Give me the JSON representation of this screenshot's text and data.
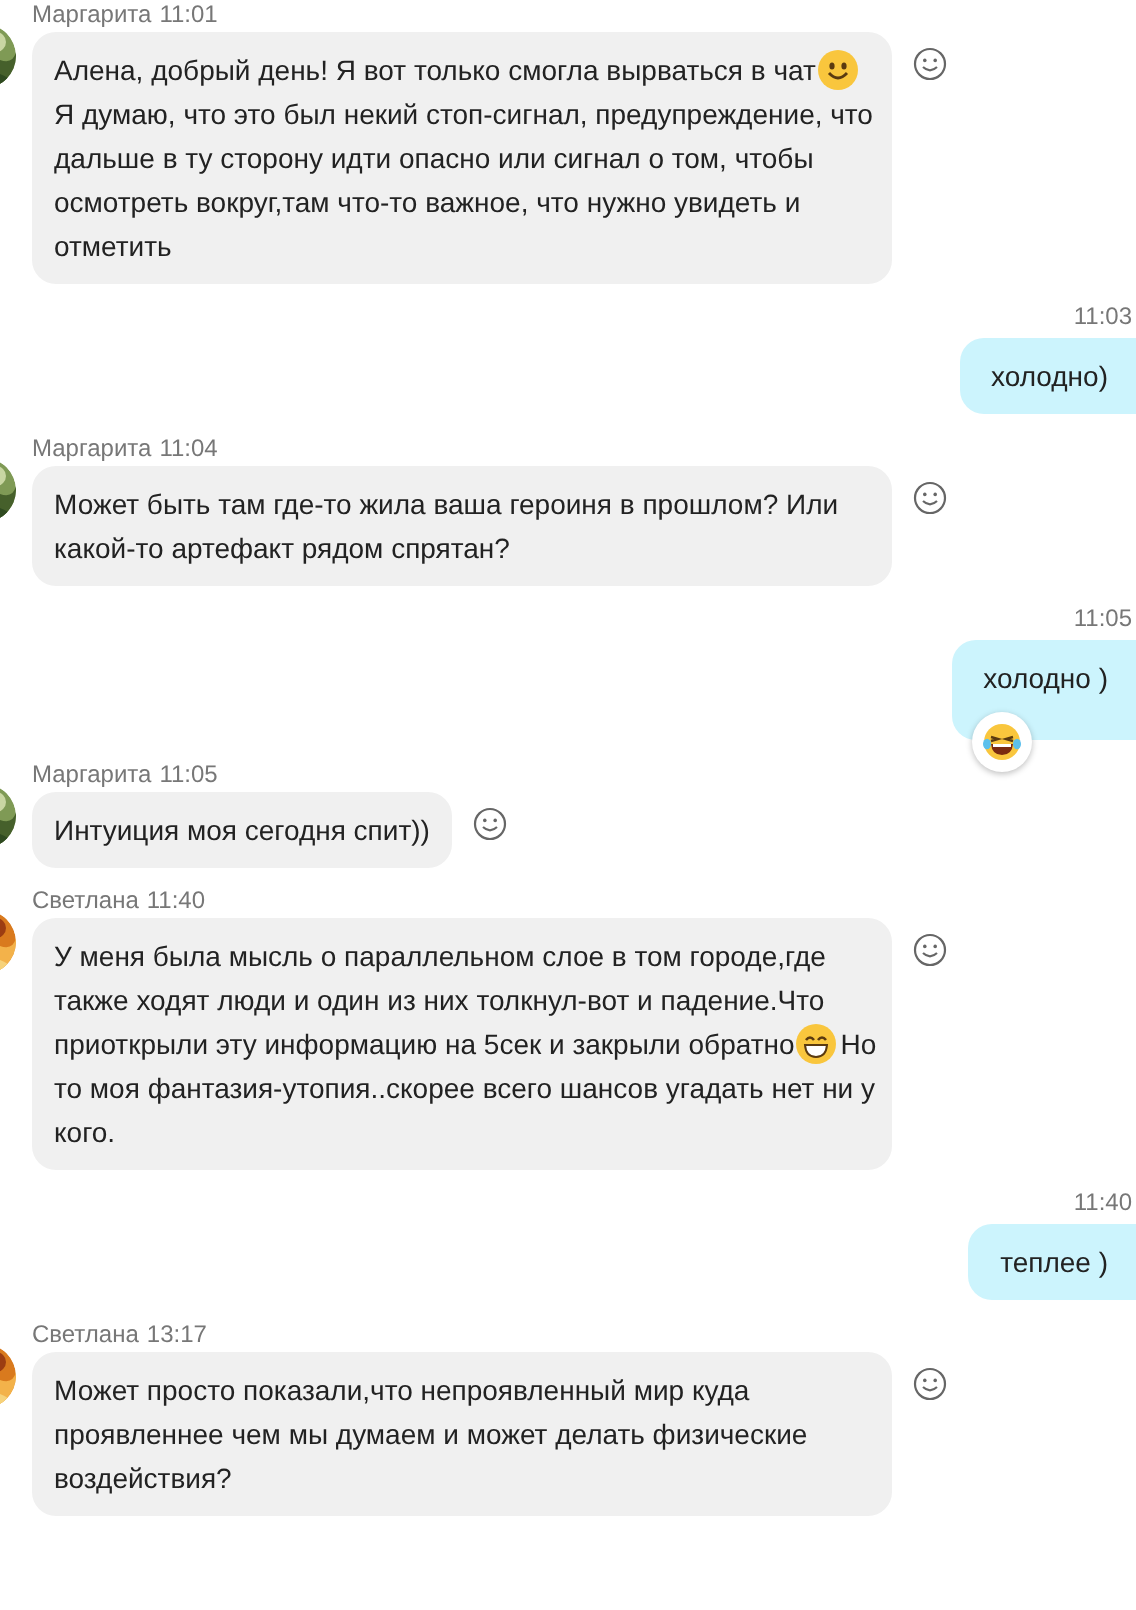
{
  "messages": [
    {
      "kind": "incoming",
      "author": "Маргарита",
      "time": "11:01",
      "avatar": {
        "kind": "picture"
      },
      "lines": [
        [
          {
            "kind": "text",
            "text": "Алена, добрый день! Я вот только смогла вырваться в чат"
          },
          {
            "kind": "smile"
          }
        ],
        [
          {
            "kind": "text",
            "text": "Я думаю, что это был некий стоп-сигнал, предупреждение, что"
          }
        ],
        [
          {
            "kind": "text",
            "text": "дальше в ту сторону идти опасно или сигнал о том, чтобы"
          }
        ],
        [
          {
            "kind": "text",
            "text": "осмотреть вокруг,там что-то важное, что нужно увидеть и"
          }
        ],
        [
          {
            "kind": "text",
            "text": "отметить"
          }
        ]
      ]
    },
    {
      "kind": "outgoing",
      "time": "11:03",
      "lines": [
        [
          {
            "kind": "text",
            "text": "холодно)"
          }
        ]
      ]
    },
    {
      "kind": "incoming",
      "author": "Маргарита",
      "time": "11:04",
      "avatar": {
        "kind": "picture"
      },
      "lines": [
        [
          {
            "kind": "text",
            "text": "Может быть там где-то жила ваша героиня в прошлом? Или"
          }
        ],
        [
          {
            "kind": "text",
            "text": "какой-то артефакт рядом спрятан?"
          }
        ]
      ]
    },
    {
      "kind": "outgoing",
      "time": "11:05",
      "reactions": [
        {
          "kind": "laugh"
        }
      ],
      "lines": [
        [
          {
            "kind": "text",
            "text": "холодно )"
          }
        ]
      ]
    },
    {
      "kind": "incoming",
      "author": "Маргарита",
      "time": "11:05",
      "avatar": {
        "kind": "picture"
      },
      "lines": [
        [
          {
            "kind": "text",
            "text": "Интуиция моя сегодня спит))"
          }
        ]
      ]
    },
    {
      "kind": "incoming",
      "author": "Светлана",
      "time": "11:40",
      "avatar": {
        "kind": "picture"
      },
      "lines": [
        [
          {
            "kind": "text",
            "text": "У меня была мысль о параллельном слое в том городе,где"
          }
        ],
        [
          {
            "kind": "text",
            "text": "также ходят люди и один из них толкнул-вот и падение.Что"
          }
        ],
        [
          {
            "kind": "text",
            "text": "приоткрыли эту информацию на 5сек и закрыли обратно"
          },
          {
            "kind": "grin"
          },
          {
            "kind": "text",
            "text": "Но"
          }
        ],
        [
          {
            "kind": "text",
            "text": "то моя фантазия-утопия..скорее всего шансов угадать нет ни у"
          }
        ],
        [
          {
            "kind": "text",
            "text": "кого."
          }
        ]
      ]
    },
    {
      "kind": "outgoing",
      "time": "11:40",
      "lines": [
        [
          {
            "kind": "text",
            "text": "теплее )"
          }
        ]
      ]
    },
    {
      "kind": "incoming",
      "author": "Светлана",
      "time": "13:17",
      "avatar": {
        "kind": "picture"
      },
      "lines": [
        [
          {
            "kind": "text",
            "text": "Может просто показали,что непроявленный мир куда"
          }
        ],
        [
          {
            "kind": "text",
            "text": "проявленнее чем мы думаем и может делать физические"
          }
        ],
        [
          {
            "kind": "text",
            "text": "воздействия?"
          }
        ]
      ]
    }
  ]
}
